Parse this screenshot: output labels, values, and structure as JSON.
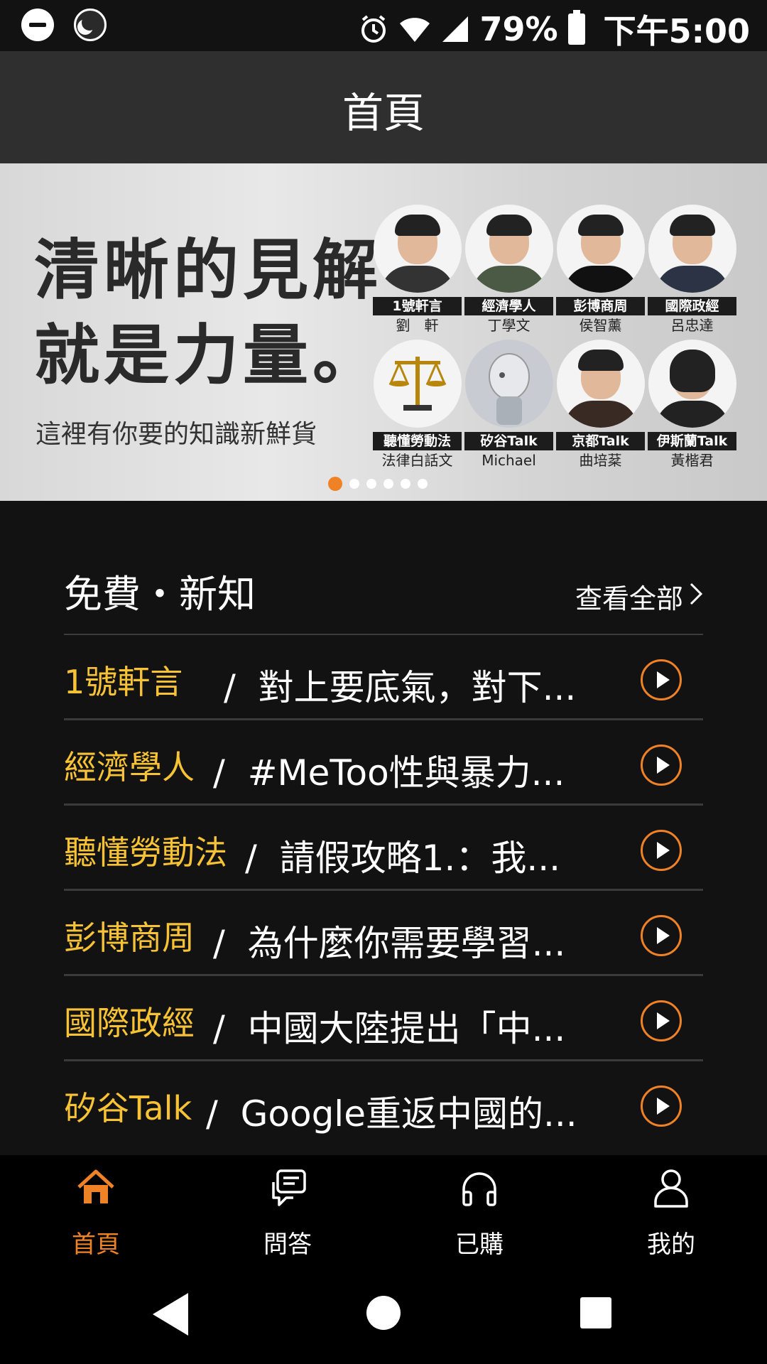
{
  "status_bar": {
    "battery": "79%",
    "time": "下午5:00"
  },
  "header": {
    "title": "首頁"
  },
  "banner": {
    "headline": [
      "清晰的見解",
      "就是力量。"
    ],
    "subtitle": "這裡有你要的知識新鮮貨",
    "people": [
      {
        "tag": "1號軒言",
        "name": "劉　軒"
      },
      {
        "tag": "經濟學人",
        "name": "丁學文"
      },
      {
        "tag": "彭博商周",
        "name": "侯智薰"
      },
      {
        "tag": "國際政經",
        "name": "呂忠達"
      },
      {
        "tag": "聽懂勞動法",
        "name": "法律白話文"
      },
      {
        "tag": "矽谷Talk",
        "name": "Michael"
      },
      {
        "tag": "京都Talk",
        "name": "曲培棻"
      },
      {
        "tag": "伊斯蘭Talk",
        "name": "黃楷君"
      }
    ],
    "dots_count": 6,
    "active_dot": 0
  },
  "free_section": {
    "title": "免費・新知",
    "see_all": "查看全部",
    "items": [
      {
        "category": "1號軒言",
        "title": "對上要底氣，對下..."
      },
      {
        "category": "經濟學人",
        "title": "#MeToo性與暴力..."
      },
      {
        "category": "聽懂勞動法",
        "title": "請假攻略1.：我..."
      },
      {
        "category": "彭博商周",
        "title": "為什麼你需要學習..."
      },
      {
        "category": "國際政經",
        "title": "中國大陸提出「中..."
      },
      {
        "category": "矽谷Talk",
        "title": "Google重返中國的..."
      }
    ]
  },
  "tab_bar": {
    "tabs": [
      {
        "label": "首頁",
        "icon": "home-icon"
      },
      {
        "label": "問答",
        "icon": "chat-icon"
      },
      {
        "label": "已購",
        "icon": "headphones-icon"
      },
      {
        "label": "我的",
        "icon": "user-icon"
      }
    ],
    "active_tab": 0
  },
  "colors": {
    "accent": "#f08226",
    "category": "#f7c234",
    "header_bg": "#2f2f2f",
    "background": "#121212"
  }
}
